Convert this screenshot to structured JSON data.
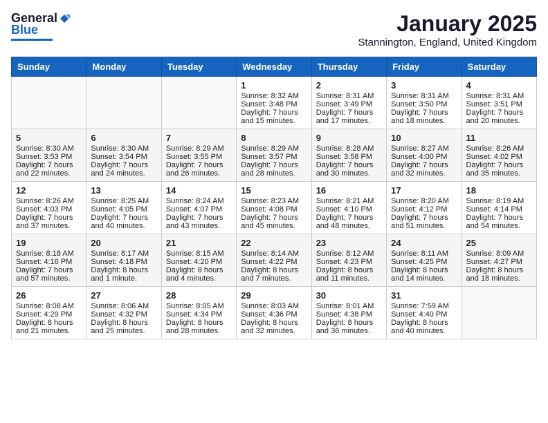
{
  "header": {
    "logo_general": "General",
    "logo_blue": "Blue",
    "month_title": "January 2025",
    "subtitle": "Stannington, England, United Kingdom"
  },
  "days_of_week": [
    "Sunday",
    "Monday",
    "Tuesday",
    "Wednesday",
    "Thursday",
    "Friday",
    "Saturday"
  ],
  "weeks": [
    [
      {
        "day": "",
        "info": ""
      },
      {
        "day": "",
        "info": ""
      },
      {
        "day": "",
        "info": ""
      },
      {
        "day": "1",
        "info": "Sunrise: 8:32 AM\nSunset: 3:48 PM\nDaylight: 7 hours and 15 minutes."
      },
      {
        "day": "2",
        "info": "Sunrise: 8:31 AM\nSunset: 3:49 PM\nDaylight: 7 hours and 17 minutes."
      },
      {
        "day": "3",
        "info": "Sunrise: 8:31 AM\nSunset: 3:50 PM\nDaylight: 7 hours and 18 minutes."
      },
      {
        "day": "4",
        "info": "Sunrise: 8:31 AM\nSunset: 3:51 PM\nDaylight: 7 hours and 20 minutes."
      }
    ],
    [
      {
        "day": "5",
        "info": "Sunrise: 8:30 AM\nSunset: 3:53 PM\nDaylight: 7 hours and 22 minutes."
      },
      {
        "day": "6",
        "info": "Sunrise: 8:30 AM\nSunset: 3:54 PM\nDaylight: 7 hours and 24 minutes."
      },
      {
        "day": "7",
        "info": "Sunrise: 8:29 AM\nSunset: 3:55 PM\nDaylight: 7 hours and 26 minutes."
      },
      {
        "day": "8",
        "info": "Sunrise: 8:29 AM\nSunset: 3:57 PM\nDaylight: 7 hours and 28 minutes."
      },
      {
        "day": "9",
        "info": "Sunrise: 8:28 AM\nSunset: 3:58 PM\nDaylight: 7 hours and 30 minutes."
      },
      {
        "day": "10",
        "info": "Sunrise: 8:27 AM\nSunset: 4:00 PM\nDaylight: 7 hours and 32 minutes."
      },
      {
        "day": "11",
        "info": "Sunrise: 8:26 AM\nSunset: 4:02 PM\nDaylight: 7 hours and 35 minutes."
      }
    ],
    [
      {
        "day": "12",
        "info": "Sunrise: 8:26 AM\nSunset: 4:03 PM\nDaylight: 7 hours and 37 minutes."
      },
      {
        "day": "13",
        "info": "Sunrise: 8:25 AM\nSunset: 4:05 PM\nDaylight: 7 hours and 40 minutes."
      },
      {
        "day": "14",
        "info": "Sunrise: 8:24 AM\nSunset: 4:07 PM\nDaylight: 7 hours and 43 minutes."
      },
      {
        "day": "15",
        "info": "Sunrise: 8:23 AM\nSunset: 4:08 PM\nDaylight: 7 hours and 45 minutes."
      },
      {
        "day": "16",
        "info": "Sunrise: 8:21 AM\nSunset: 4:10 PM\nDaylight: 7 hours and 48 minutes."
      },
      {
        "day": "17",
        "info": "Sunrise: 8:20 AM\nSunset: 4:12 PM\nDaylight: 7 hours and 51 minutes."
      },
      {
        "day": "18",
        "info": "Sunrise: 8:19 AM\nSunset: 4:14 PM\nDaylight: 7 hours and 54 minutes."
      }
    ],
    [
      {
        "day": "19",
        "info": "Sunrise: 8:18 AM\nSunset: 4:16 PM\nDaylight: 7 hours and 57 minutes."
      },
      {
        "day": "20",
        "info": "Sunrise: 8:17 AM\nSunset: 4:18 PM\nDaylight: 8 hours and 1 minute."
      },
      {
        "day": "21",
        "info": "Sunrise: 8:15 AM\nSunset: 4:20 PM\nDaylight: 8 hours and 4 minutes."
      },
      {
        "day": "22",
        "info": "Sunrise: 8:14 AM\nSunset: 4:22 PM\nDaylight: 8 hours and 7 minutes."
      },
      {
        "day": "23",
        "info": "Sunrise: 8:12 AM\nSunset: 4:23 PM\nDaylight: 8 hours and 11 minutes."
      },
      {
        "day": "24",
        "info": "Sunrise: 8:11 AM\nSunset: 4:25 PM\nDaylight: 8 hours and 14 minutes."
      },
      {
        "day": "25",
        "info": "Sunrise: 8:09 AM\nSunset: 4:27 PM\nDaylight: 8 hours and 18 minutes."
      }
    ],
    [
      {
        "day": "26",
        "info": "Sunrise: 8:08 AM\nSunset: 4:29 PM\nDaylight: 8 hours and 21 minutes."
      },
      {
        "day": "27",
        "info": "Sunrise: 8:06 AM\nSunset: 4:32 PM\nDaylight: 8 hours and 25 minutes."
      },
      {
        "day": "28",
        "info": "Sunrise: 8:05 AM\nSunset: 4:34 PM\nDaylight: 8 hours and 28 minutes."
      },
      {
        "day": "29",
        "info": "Sunrise: 8:03 AM\nSunset: 4:36 PM\nDaylight: 8 hours and 32 minutes."
      },
      {
        "day": "30",
        "info": "Sunrise: 8:01 AM\nSunset: 4:38 PM\nDaylight: 8 hours and 36 minutes."
      },
      {
        "day": "31",
        "info": "Sunrise: 7:59 AM\nSunset: 4:40 PM\nDaylight: 8 hours and 40 minutes."
      },
      {
        "day": "",
        "info": ""
      }
    ]
  ]
}
